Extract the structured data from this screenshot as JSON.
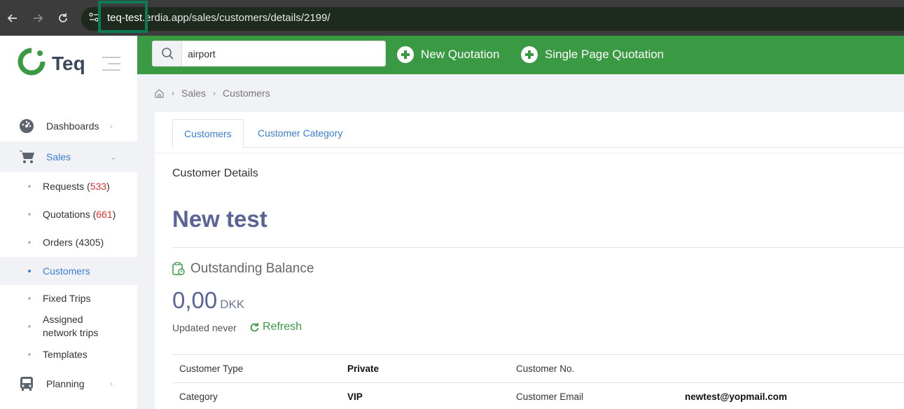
{
  "browser": {
    "url_host": "teq-test.",
    "url_rest": "erdia.app/sales/customers/details/2199/"
  },
  "sidebar": {
    "logo_text": "Teq",
    "menu": {
      "dashboards": "Dashboards",
      "sales": "Sales",
      "planning": "Planning"
    },
    "sales_items": {
      "requests_label": "Requests (",
      "requests_count": "533",
      "requests_close": ")",
      "quotations_label": "Quotations (",
      "quotations_count": "661",
      "quotations_close": ")",
      "orders": "Orders (4305)",
      "customers": "Customers",
      "fixed_trips": "Fixed Trips",
      "assigned_line1": "Assigned",
      "assigned_line2": "network trips",
      "templates": "Templates"
    }
  },
  "topbar": {
    "search_value": "airport",
    "new_quotation": "New Quotation",
    "single_page_quotation": "Single Page Quotation"
  },
  "breadcrumb": {
    "sales": "Sales",
    "customers": "Customers"
  },
  "tabs": {
    "customers": "Customers",
    "customer_category": "Customer Category"
  },
  "details": {
    "section_title": "Customer Details",
    "customer_name": "New test",
    "outstanding_title": "Outstanding Balance",
    "balance_amount": "0,00",
    "balance_currency": "DKK",
    "updated_text": "Updated never",
    "refresh_label": "Refresh",
    "rows": [
      {
        "label1": "Customer Type",
        "value1": "Private",
        "label2": "Customer No.",
        "value2": ""
      },
      {
        "label1": "Category",
        "value1": "VIP",
        "label2": "Customer Email",
        "value2": "newtest@yopmail.com"
      }
    ]
  },
  "colors": {
    "brand_green": "#3a9a43",
    "link_blue": "#3b7dd8",
    "title_indigo": "#5a6496",
    "count_red": "#e0312b"
  }
}
